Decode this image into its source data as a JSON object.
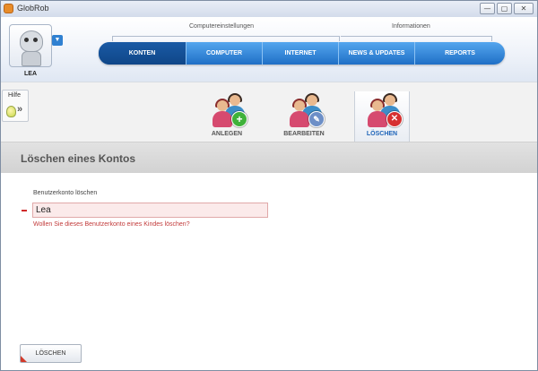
{
  "window": {
    "title": "GlobRob",
    "controls": {
      "minimize": "—",
      "maximize": "▢",
      "close": "✕"
    }
  },
  "user": {
    "name": "LEA"
  },
  "groups": {
    "settings": "Computereinstellungen",
    "info": "Informationen"
  },
  "nav": {
    "tabs": [
      {
        "label": "KONTEN",
        "active": true
      },
      {
        "label": "COMPUTER",
        "active": false
      },
      {
        "label": "INTERNET",
        "active": false
      },
      {
        "label": "NEWS & UPDATES",
        "active": false
      },
      {
        "label": "REPORTS",
        "active": false
      }
    ]
  },
  "help": {
    "label": "Hilfe",
    "chevron": "»"
  },
  "tools": {
    "add": {
      "label": "ANLEGEN",
      "icon": "user-add-icon"
    },
    "edit": {
      "label": "BEARBEITEN",
      "icon": "user-edit-icon"
    },
    "delete": {
      "label": "LÖSCHEN",
      "icon": "user-delete-icon",
      "active": true
    }
  },
  "section": {
    "title": "Löschen eines Kontos"
  },
  "form": {
    "label": "Benutzerkonto löschen",
    "value": "Lea",
    "question": "Wollen Sie dieses Benutzerkonto eines Kindes löschen?"
  },
  "actions": {
    "delete_label": "LÖSCHEN"
  },
  "colors": {
    "accent": "#2f80d1",
    "error": "#c23b3b",
    "active_tab": "#0f4688"
  }
}
